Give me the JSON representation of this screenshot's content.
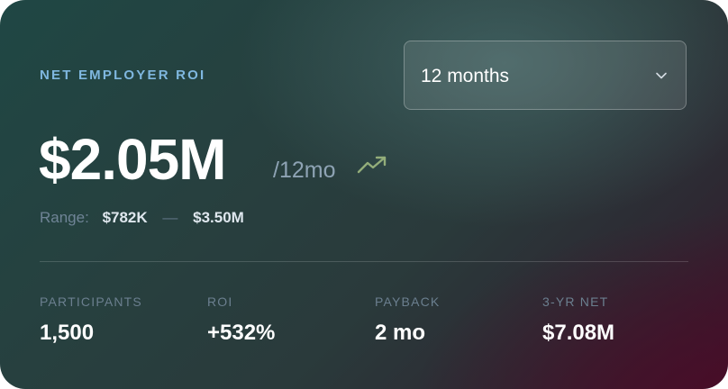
{
  "card": {
    "title": "NET EMPLOYER ROI",
    "period_select": {
      "selected": "12 months"
    },
    "value": "$2.05M",
    "per_period": "/12mo",
    "trend_icon": "trending-up-icon",
    "range": {
      "label": "Range:",
      "min": "$782K",
      "separator": "—",
      "max": "$3.50M"
    },
    "stats": [
      {
        "label": "PARTICIPANTS",
        "value": "1,500"
      },
      {
        "label": "ROI",
        "value": "+532%"
      },
      {
        "label": "PAYBACK",
        "value": "2 mo"
      },
      {
        "label": "3-YR NET",
        "value": "$7.08M"
      }
    ]
  },
  "colors": {
    "label_accent": "#7fb7df",
    "trend_icon": "#93ad7a",
    "value_text": "#ffffff",
    "muted_text": "#6f8496"
  }
}
